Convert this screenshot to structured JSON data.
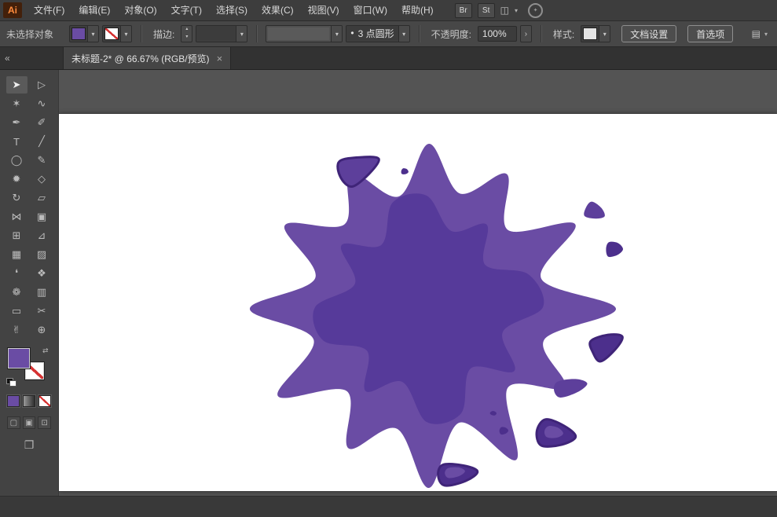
{
  "app": {
    "logo_text": "Ai"
  },
  "menubar": {
    "items": [
      "文件(F)",
      "编辑(E)",
      "对象(O)",
      "文字(T)",
      "选择(S)",
      "效果(C)",
      "视图(V)",
      "窗口(W)",
      "帮助(H)"
    ],
    "br_button": "Br",
    "st_button": "St",
    "arrange_icon": "◫",
    "chevron": "▾",
    "cs_live_icon": "✦"
  },
  "controlbar": {
    "selection_status": "未选择对象",
    "stroke_label": "描边:",
    "stepper_up": "▴",
    "stepper_down": "▾",
    "chevron": "▾",
    "brush_dot": "•",
    "brush_value": "3 点圆形",
    "opacity_label": "不透明度:",
    "opacity_value": "100%",
    "opacity_more": "›",
    "style_label": "样式:",
    "style_swatch_color": "#e4e4e4",
    "doc_setup_button": "文档设置",
    "preferences_button": "首选项",
    "panel_icon": "▤"
  },
  "tabbar": {
    "collapse_icon": "«",
    "tab_title": "未标题-2* @ 66.67% (RGB/预览)",
    "close_icon": "×"
  },
  "toolbar": {
    "tools": [
      {
        "name": "selection",
        "glyph": "➤",
        "active": true
      },
      {
        "name": "direct-selection",
        "glyph": "▷",
        "active": false
      },
      {
        "name": "magic-wand",
        "glyph": "✶",
        "active": false
      },
      {
        "name": "lasso",
        "glyph": "∿",
        "active": false
      },
      {
        "name": "pen",
        "glyph": "✒",
        "active": false
      },
      {
        "name": "paintbrush",
        "glyph": "✐",
        "active": false
      },
      {
        "name": "type",
        "glyph": "T",
        "active": false
      },
      {
        "name": "line-segment",
        "glyph": "╱",
        "active": false
      },
      {
        "name": "ellipse",
        "glyph": "◯",
        "active": false
      },
      {
        "name": "pencil",
        "glyph": "✎",
        "active": false
      },
      {
        "name": "blob-brush",
        "glyph": "✹",
        "active": false
      },
      {
        "name": "eraser",
        "glyph": "◇",
        "active": false
      },
      {
        "name": "rotate",
        "glyph": "↻",
        "active": false
      },
      {
        "name": "scale",
        "glyph": "▱",
        "active": false
      },
      {
        "name": "width-tool",
        "glyph": "⋈",
        "active": false
      },
      {
        "name": "free-transform",
        "glyph": "▣",
        "active": false
      },
      {
        "name": "shape-builder",
        "glyph": "⊞",
        "active": false
      },
      {
        "name": "perspective-grid",
        "glyph": "⊿",
        "active": false
      },
      {
        "name": "mesh",
        "glyph": "▦",
        "active": false
      },
      {
        "name": "gradient",
        "glyph": "▨",
        "active": false
      },
      {
        "name": "eyedropper",
        "glyph": "❛",
        "active": false
      },
      {
        "name": "blend",
        "glyph": "❖",
        "active": false
      },
      {
        "name": "symbol-sprayer",
        "glyph": "❁",
        "active": false
      },
      {
        "name": "column-graph",
        "glyph": "▥",
        "active": false
      },
      {
        "name": "artboard",
        "glyph": "▭",
        "active": false
      },
      {
        "name": "slice",
        "glyph": "✂",
        "active": false
      },
      {
        "name": "hand",
        "glyph": "✌",
        "active": false
      },
      {
        "name": "zoom",
        "glyph": "⊕",
        "active": false
      }
    ],
    "swap_icon": "⇄",
    "draw_mode_icons": [
      "▢",
      "▣",
      "⊡"
    ],
    "screen_mode_icon": "❐"
  },
  "swatches": {
    "fill_color": "#6a4ca4",
    "stroke_style": "none"
  },
  "canvas": {
    "splatter": {
      "outer": "#6a4ca4",
      "inner": "#563a9a",
      "mid": "#5d3f9b",
      "dark": "#4c2f8c",
      "rim": "#3f2478"
    }
  }
}
